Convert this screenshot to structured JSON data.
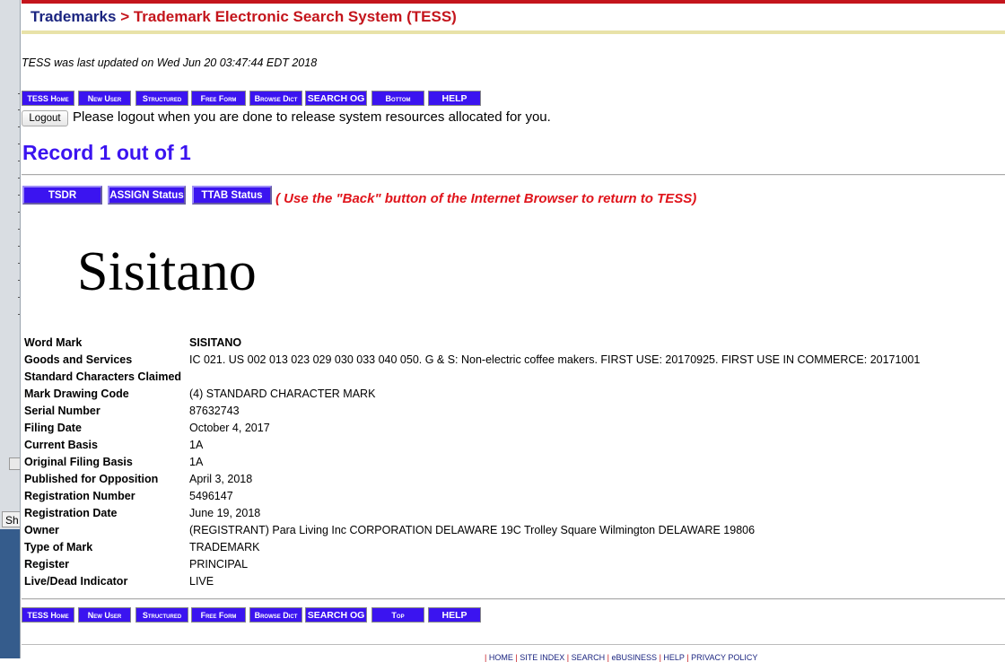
{
  "header": {
    "breadcrumb_link": "Trademarks",
    "breadcrumb_sep": ">",
    "breadcrumb_current": "Trademark Electronic Search System (TESS)"
  },
  "updated_text": "TESS was last updated on Wed Jun 20 03:47:44 EDT 2018",
  "nav_top": [
    "TESS Home",
    "New User",
    "Structured",
    "Free Form",
    "Browse Dict",
    "SEARCH OG",
    "Bottom",
    "HELP"
  ],
  "nav_bottom": [
    "TESS Home",
    "New User",
    "Structured",
    "Free Form",
    "Browse Dict",
    "SEARCH OG",
    "Top",
    "HELP"
  ],
  "logout": {
    "button_label": "Logout",
    "message": "Please logout when you are done to release system resources allocated for you."
  },
  "record_title": "Record 1 out of 1",
  "actions": {
    "tsdr": "TSDR",
    "assign": "ASSIGN Status",
    "ttab": "TTAB Status",
    "back_note": "( Use the \"Back\" button of the Internet Browser to return to TESS)"
  },
  "mark_image_text": "Sisitano",
  "fields": [
    {
      "label": "Word Mark",
      "value": "SISITANO",
      "bold": true
    },
    {
      "label": "Goods and Services",
      "value": "IC 021. US 002 013 023 029 030 033 040 050. G & S: Non-electric coffee makers. FIRST USE: 20170925. FIRST USE IN COMMERCE: 20171001"
    },
    {
      "label": "Standard Characters Claimed",
      "value": ""
    },
    {
      "label": "Mark Drawing Code",
      "value": "(4) STANDARD CHARACTER MARK"
    },
    {
      "label": "Serial Number",
      "value": "87632743"
    },
    {
      "label": "Filing Date",
      "value": "October 4, 2017"
    },
    {
      "label": "Current Basis",
      "value": "1A"
    },
    {
      "label": "Original Filing Basis",
      "value": "1A"
    },
    {
      "label": "Published for Opposition",
      "value": "April 3, 2018"
    },
    {
      "label": "Registration Number",
      "value": "5496147"
    },
    {
      "label": "Registration Date",
      "value": "June 19, 2018"
    },
    {
      "label": "Owner",
      "value": "(REGISTRANT) Para Living Inc CORPORATION DELAWARE 19C Trolley Square Wilmington DELAWARE 19806"
    },
    {
      "label": "Type of Mark",
      "value": "TRADEMARK"
    },
    {
      "label": "Register",
      "value": "PRINCIPAL"
    },
    {
      "label": "Live/Dead Indicator",
      "value": "LIVE"
    }
  ],
  "footer": {
    "links": [
      "HOME",
      "SITE INDEX",
      "SEARCH",
      "eBUSINESS",
      "HELP",
      "PRIVACY POLICY"
    ]
  },
  "side_strip": {
    "tab_label": "Sh"
  },
  "colors": {
    "nav_button": "#3b14f0",
    "accent_red": "#c4151c",
    "title_blue": "#3b14f0",
    "breadcrumb_blue": "#1b2580"
  }
}
